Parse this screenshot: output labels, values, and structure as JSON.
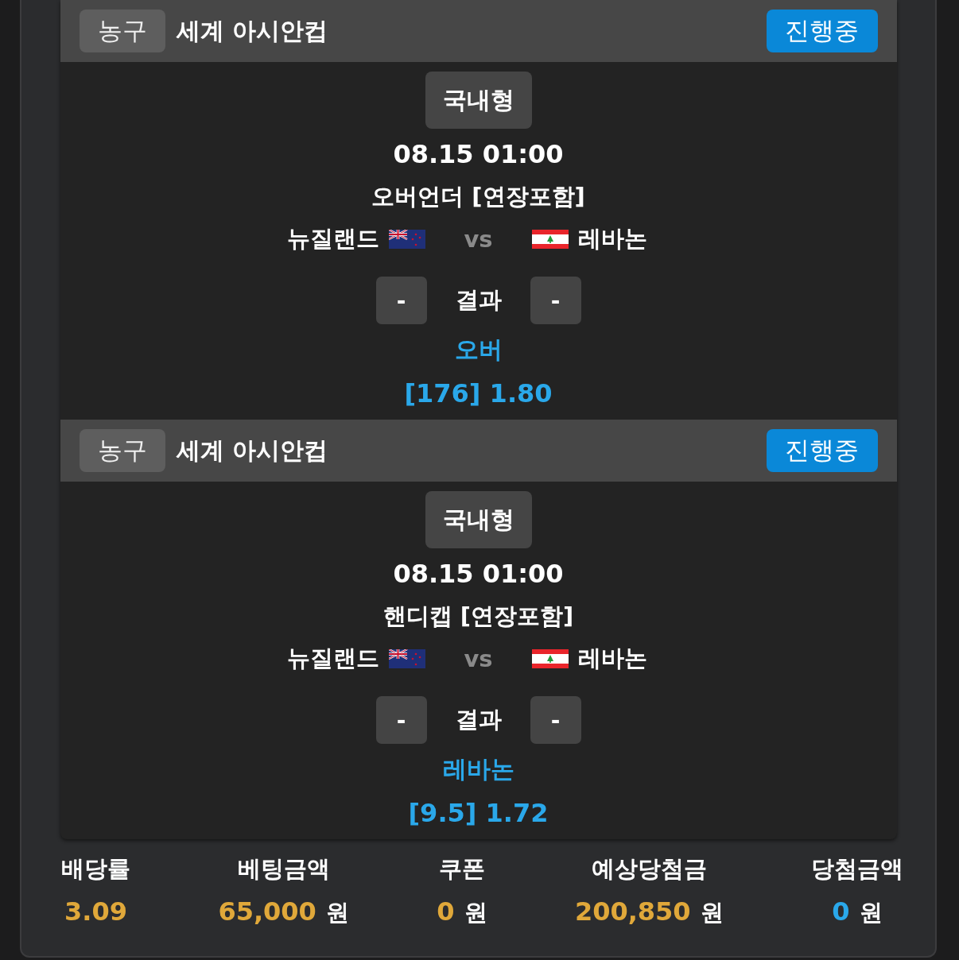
{
  "matches": [
    {
      "sport": "농구",
      "league": "세계 아시안컵",
      "status": "진행중",
      "type": "국내형",
      "datetime": "08.15 01:00",
      "market": "오버언더 [연장포함]",
      "home": "뉴질랜드",
      "vs": "vs",
      "away": "레바논",
      "home_score": "-",
      "result_label": "결과",
      "away_score": "-",
      "pick": "오버",
      "odds": "[176] 1.80"
    },
    {
      "sport": "농구",
      "league": "세계 아시안컵",
      "status": "진행중",
      "type": "국내형",
      "datetime": "08.15 01:00",
      "market": "핸디캡 [연장포함]",
      "home": "뉴질랜드",
      "vs": "vs",
      "away": "레바논",
      "home_score": "-",
      "result_label": "결과",
      "away_score": "-",
      "pick": "레바논",
      "odds": "[9.5] 1.72"
    }
  ],
  "summary": [
    {
      "label": "배당률",
      "value": "3.09",
      "color": "#e0a83a"
    },
    {
      "label": "베팅금액",
      "value": "65,000",
      "unit": "원",
      "color": "#e0a83a"
    },
    {
      "label": "쿠폰",
      "value": "0",
      "unit": "원",
      "color": "#e0a83a"
    },
    {
      "label": "예상당첨금",
      "value": "200,850",
      "unit": "원",
      "color": "#e0a83a"
    },
    {
      "label": "당첨금액",
      "value": "0",
      "unit": "원",
      "color": "#2aa8ea"
    }
  ]
}
